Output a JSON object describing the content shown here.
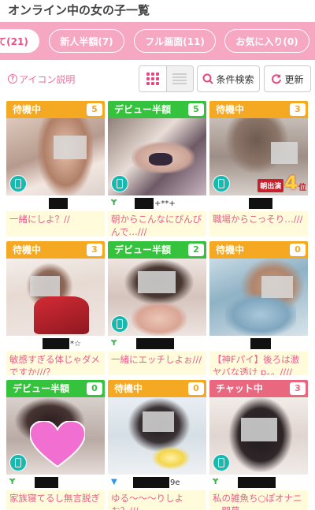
{
  "header": {
    "title": "オンライン中の女の子一覧"
  },
  "tabs": [
    {
      "label": "て(21)",
      "active": true
    },
    {
      "label": "新人半額(7)",
      "active": false
    },
    {
      "label": "フル画面(11)",
      "active": false
    },
    {
      "label": "お気に入り(0)",
      "active": false
    }
  ],
  "toolbar": {
    "icon_help": "アイコン説明",
    "search_label": "条件検索",
    "refresh_label": "更新"
  },
  "colors": {
    "tab_bar": "#f6a7c2",
    "status_waiting": "#f5a822",
    "status_debut": "#35c23c",
    "status_chat": "#ea6780",
    "message": "#ea5d8c",
    "card_bg": "#fffbdb"
  },
  "cards": [
    {
      "status": "待機中",
      "status_type": "waiting",
      "count": "5",
      "name_tail": "",
      "message": "一緒にしよ？//",
      "phone": true,
      "sprout": false
    },
    {
      "status": "デビュー半額",
      "status_type": "debut",
      "count": "5",
      "name_tail": "+**+",
      "message": "朝からこんなにぴんびんで…///",
      "phone": true,
      "sprout": true
    },
    {
      "status": "待機中",
      "status_type": "waiting",
      "count": "3",
      "name_tail": "",
      "message": "職場からこっそり…///",
      "phone": true,
      "sprout": false,
      "rank": {
        "label": "朝出演",
        "number": "4",
        "suffix": "位"
      }
    },
    {
      "status": "待機中",
      "status_type": "waiting",
      "count": "3",
      "name_tail": "*☆",
      "message": "敏感すぎる体じゃダメですか///？",
      "phone": false,
      "sprout": false
    },
    {
      "status": "デビュー半額",
      "status_type": "debut",
      "count": "2",
      "name_tail": "",
      "message": "一緒にエッチしよぉ///",
      "phone": true,
      "sprout": true
    },
    {
      "status": "待機中",
      "status_type": "waiting",
      "count": "0",
      "name_tail": "",
      "message": "【神Fパイ】後ろは激ヤバな透け p。。////",
      "phone": false,
      "sprout": false
    },
    {
      "status": "デビュー半額",
      "status_type": "debut",
      "count": "0",
      "name_tail": "",
      "message": "家族寝てるし無言脱ぎ",
      "phone": true,
      "sprout": true
    },
    {
      "status": "待機中",
      "status_type": "waiting",
      "count": "0",
      "name_tail": "9e",
      "message": "ゆる～～～りしよお？///",
      "phone": false,
      "sprout": false,
      "leaf": true
    },
    {
      "status": "チャット中",
      "status_type": "chat",
      "count": "3",
      "name_tail": "",
      "message": "私の雑魚ち○ぽオナニー開幕",
      "phone": true,
      "sprout": true
    }
  ]
}
